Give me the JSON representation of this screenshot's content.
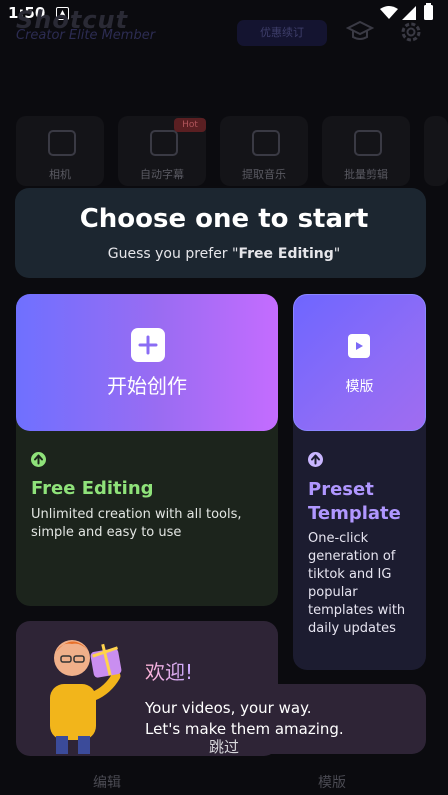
{
  "status_bar": {
    "time": "1:50"
  },
  "app": {
    "logo_title": "Shotcut",
    "logo_subtitle": "Creator Elite Member",
    "vip_label": "优惠续订",
    "tools": [
      {
        "label": "相机",
        "icon": "camera-icon"
      },
      {
        "label": "自动字幕",
        "icon": "caption-icon",
        "badge": "Hot"
      },
      {
        "label": "提取音乐",
        "icon": "music-extract-icon"
      },
      {
        "label": "批量剪辑",
        "icon": "batch-edit-icon"
      }
    ],
    "bottom_tabs": [
      "编辑",
      "模版"
    ]
  },
  "chooser": {
    "title": "Choose one to start",
    "subtitle_prefix": "Guess you prefer \"",
    "subtitle_pick": "Free Editing",
    "subtitle_suffix": "\""
  },
  "free_editing": {
    "button_label": "开始创作",
    "title": "Free Editing",
    "desc": "Unlimited creation with all tools, simple and easy to use",
    "accent": "#8fe27a"
  },
  "preset_template": {
    "button_label": "模版",
    "title": "Preset Template",
    "desc": "One-click generation of tiktok and IG popular templates with daily updates",
    "accent": "#b097ff"
  },
  "welcome": {
    "title": "欢迎!",
    "line1": "Your videos, your way.",
    "line2": "Let's make them amazing."
  },
  "skip_label": "跳过"
}
